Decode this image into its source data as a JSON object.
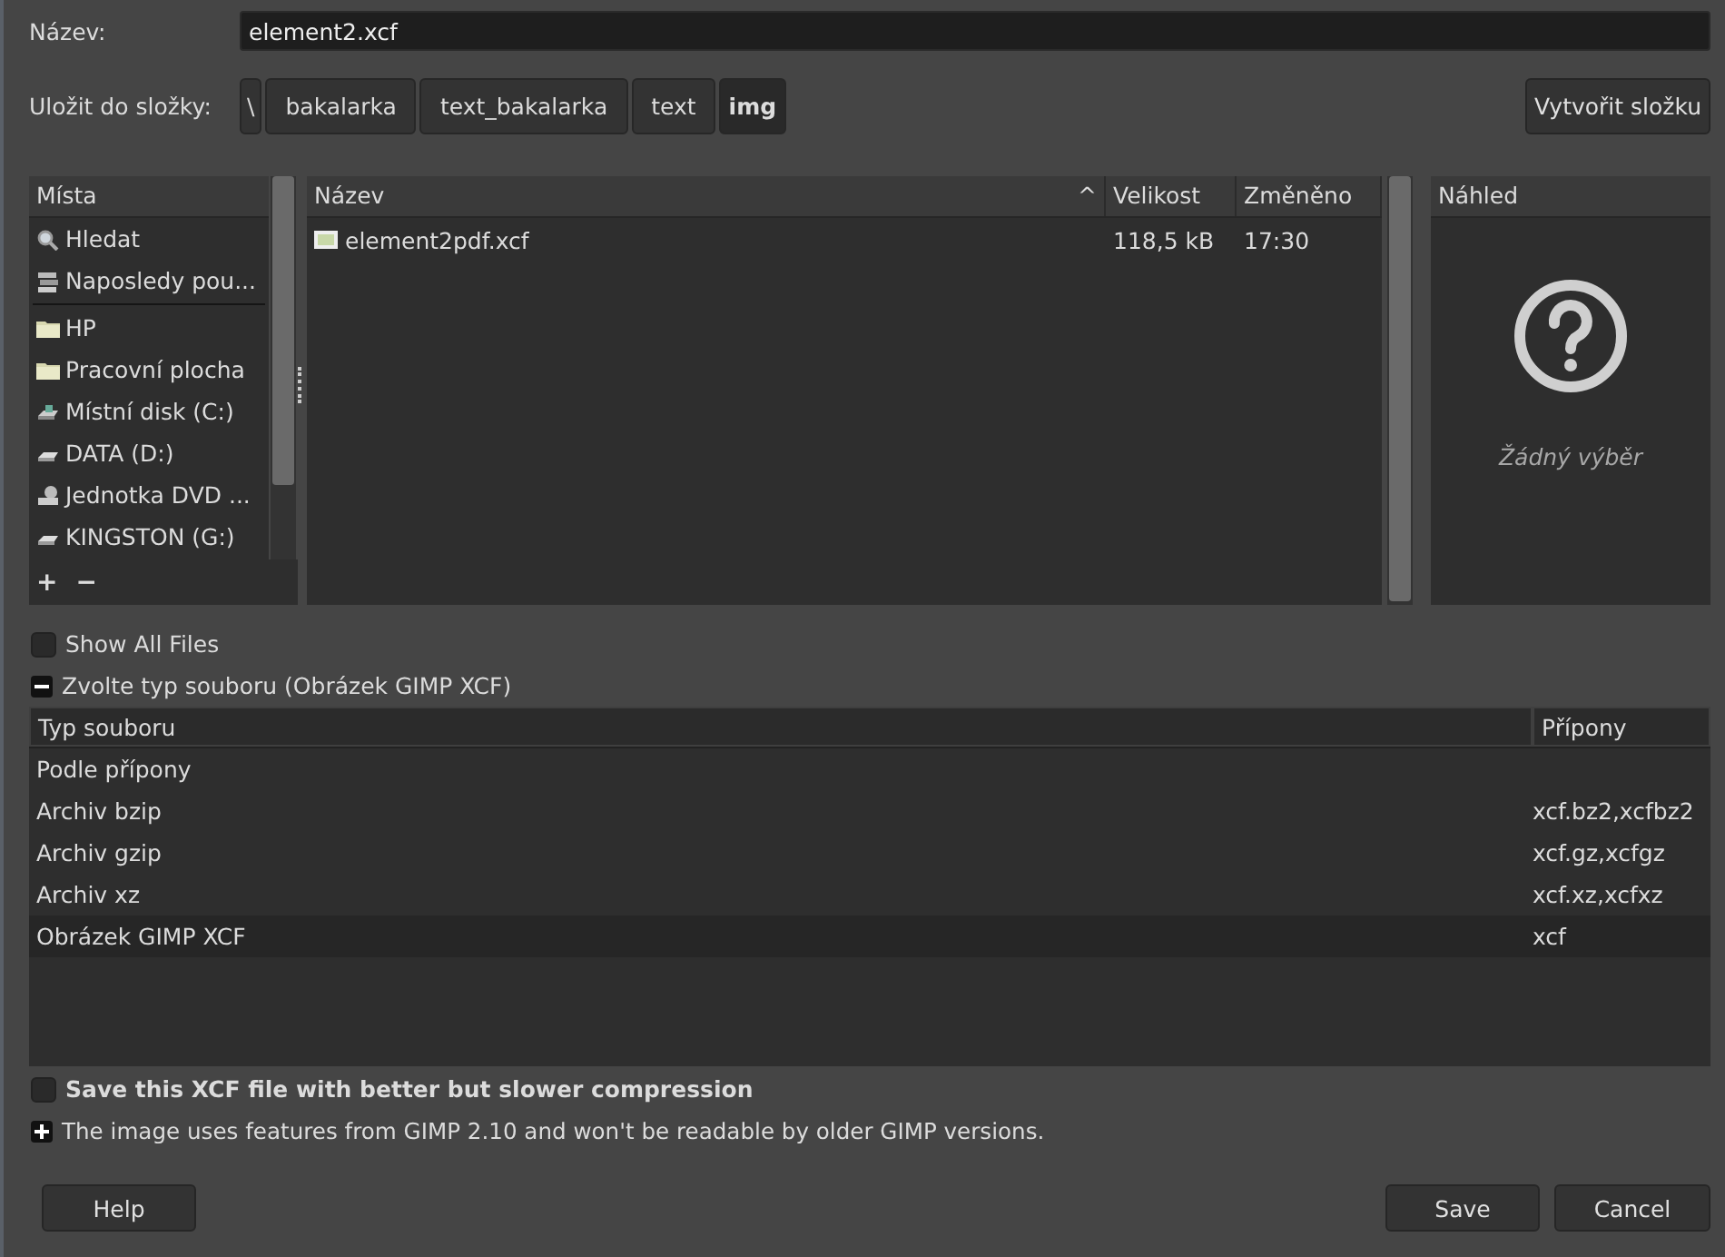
{
  "name_field": {
    "label": "Název:",
    "value": "element2.xcf"
  },
  "folder": {
    "label": "Uložit do složky:",
    "path": [
      {
        "label": "\\",
        "selected": false
      },
      {
        "label": "bakalarka",
        "selected": false
      },
      {
        "label": "text_bakalarka",
        "selected": false
      },
      {
        "label": "text",
        "selected": false
      },
      {
        "label": "img",
        "selected": true
      }
    ],
    "create_button": "Vytvořit složku"
  },
  "places": {
    "header": "Místa",
    "sections": [
      [
        {
          "label": "Hledat",
          "kind": "search"
        },
        {
          "label": "Naposledy pou...",
          "kind": "recent"
        }
      ],
      [
        {
          "label": "HP",
          "kind": "folder"
        },
        {
          "label": "Pracovní plocha",
          "kind": "folder"
        },
        {
          "label": "Místní disk (C:)",
          "kind": "system-disk"
        },
        {
          "label": "DATA (D:)",
          "kind": "disk"
        },
        {
          "label": "Jednotka DVD ...",
          "kind": "optical"
        },
        {
          "label": "KINGSTON (G:)",
          "kind": "disk"
        }
      ]
    ],
    "add": "+",
    "remove": "−"
  },
  "files": {
    "columns": [
      "Název",
      "Velikost",
      "Změněno"
    ],
    "sort_indicator": "^",
    "rows": [
      {
        "name": "element2pdf.xcf",
        "size": "118,5 kB",
        "modified": "17:30"
      }
    ]
  },
  "preview": {
    "header": "Náhled",
    "message": "Žádný výběr"
  },
  "show_all_files": {
    "label": "Show All Files",
    "checked": false
  },
  "file_type": {
    "label": "Zvolte typ souboru (Obrázek GIMP XCF)",
    "expanded": true,
    "columns": [
      "Typ souboru",
      "Přípony"
    ],
    "rows": [
      {
        "type": "Podle přípony",
        "ext": "",
        "selected": false
      },
      {
        "type": "Archiv bzip",
        "ext": "xcf.bz2,xcfbz2",
        "selected": false
      },
      {
        "type": "Archiv gzip",
        "ext": "xcf.gz,xcfgz",
        "selected": false
      },
      {
        "type": "Archiv xz",
        "ext": "xcf.xz,xcfxz",
        "selected": false
      },
      {
        "type": "Obrázek GIMP XCF",
        "ext": "xcf",
        "selected": true
      }
    ]
  },
  "compression": {
    "label": "Save this XCF file with better but slower compression",
    "checked": false
  },
  "compat_info": {
    "label": "The image uses features from GIMP 2.10 and won't be readable by older GIMP versions.",
    "expanded": false
  },
  "buttons": {
    "help": "Help",
    "save": "Save",
    "cancel": "Cancel"
  }
}
